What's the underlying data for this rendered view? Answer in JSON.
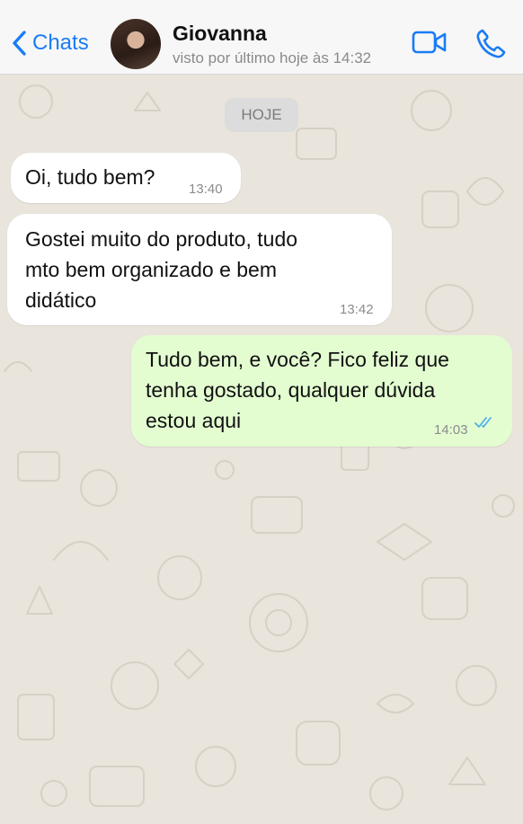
{
  "header": {
    "back_label": "Chats",
    "contact_name": "Giovanna",
    "contact_status": "visto por último hoje às 14:32"
  },
  "icons": {
    "back": "chevron-left-icon",
    "video": "video-camera-icon",
    "phone": "phone-icon",
    "read_receipt": "double-check-icon"
  },
  "colors": {
    "accent": "#1a7cf5",
    "incoming_bubble": "#ffffff",
    "outgoing_bubble": "#e3fdd1",
    "read_ticks": "#4fb1e9",
    "chat_background": "#e9e4dc"
  },
  "chat": {
    "date_separator": "HOJE",
    "messages": [
      {
        "direction": "incoming",
        "lines": [
          "Oi, tudo bem?"
        ],
        "time": "13:40"
      },
      {
        "direction": "incoming",
        "lines": [
          "Gostei muito do produto, tudo",
          "mto bem organizado e bem",
          "didático"
        ],
        "time": "13:42"
      },
      {
        "direction": "outgoing",
        "lines": [
          "Tudo bem, e você? Fico feliz que",
          "tenha gostado, qualquer dúvida",
          "estou aqui"
        ],
        "time": "14:03",
        "status": "read"
      }
    ]
  }
}
